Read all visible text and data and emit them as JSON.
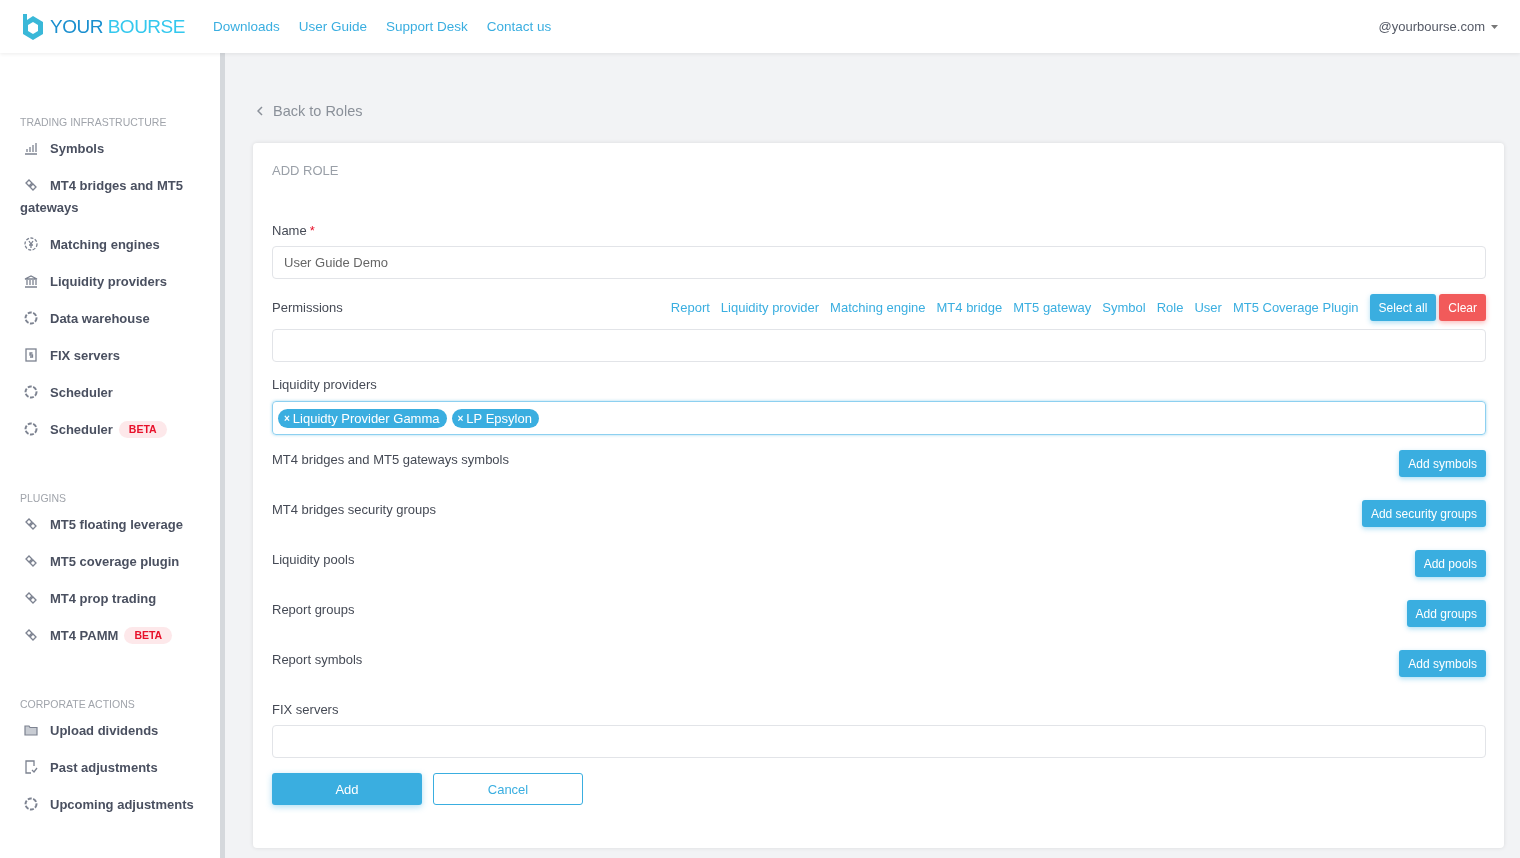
{
  "header": {
    "brand": {
      "first": "YOUR",
      "second": "BOURSE"
    },
    "nav": [
      "Downloads",
      "User Guide",
      "Support Desk",
      "Contact us"
    ],
    "account": "@yourbourse.com"
  },
  "sidebar": [
    {
      "title": "TRADING INFRASTRUCTURE",
      "items": [
        {
          "label": "Symbols",
          "kind": "chart"
        },
        {
          "label": "MT4 bridges and MT5 gateways",
          "kind": "link"
        },
        {
          "label": "Matching engines",
          "kind": "coin"
        },
        {
          "label": "Liquidity providers",
          "kind": "bank"
        },
        {
          "label": "Data warehouse",
          "kind": "ring"
        },
        {
          "label": "FIX servers",
          "kind": "doc"
        },
        {
          "label": "Scheduler",
          "kind": "ring"
        },
        {
          "label": "Scheduler",
          "kind": "ring",
          "badge": "BETA"
        }
      ]
    },
    {
      "title": "PLUGINS",
      "items": [
        {
          "label": "MT5 floating leverage",
          "kind": "link"
        },
        {
          "label": "MT5 coverage plugin",
          "kind": "link"
        },
        {
          "label": "MT4 prop trading",
          "kind": "link"
        },
        {
          "label": "MT4 PAMM",
          "kind": "link",
          "badge": "BETA"
        }
      ]
    },
    {
      "title": "CORPORATE ACTIONS",
      "items": [
        {
          "label": "Upload dividends",
          "kind": "folder"
        },
        {
          "label": "Past adjustments",
          "kind": "check"
        },
        {
          "label": "Upcoming adjustments",
          "kind": "ring"
        }
      ]
    }
  ],
  "back_link": "Back to Roles",
  "card_title": "ADD ROLE",
  "fields": [
    {
      "kind": "text",
      "label": "Name",
      "required_mark": "*",
      "value": "User Guide Demo"
    },
    {
      "kind": "permissions",
      "label": "Permissions",
      "links": [
        "Report",
        "Liquidity provider",
        "Matching engine",
        "MT4 bridge",
        "MT5 gateway",
        "Symbol",
        "Role",
        "User",
        "MT5 Coverage Plugin"
      ],
      "select_all": "Select all",
      "clear": "Clear"
    },
    {
      "kind": "tags",
      "label": "Liquidity providers",
      "tags": [
        {
          "remove": "×",
          "label": "Liquidty Provider Gamma"
        },
        {
          "remove": "×",
          "label": "LP Epsylon"
        }
      ]
    },
    {
      "kind": "action",
      "label": "MT4 bridges and MT5 gateways symbols",
      "button": "Add symbols"
    },
    {
      "kind": "action",
      "label": "MT4 bridges security groups",
      "button": "Add security groups"
    },
    {
      "kind": "action",
      "label": "Liquidity pools",
      "button": "Add pools"
    },
    {
      "kind": "action",
      "label": "Report groups",
      "button": "Add groups"
    },
    {
      "kind": "action",
      "label": "Report symbols",
      "button": "Add symbols"
    },
    {
      "kind": "text",
      "label": "FIX servers"
    }
  ],
  "buttons": {
    "submit": "Add",
    "cancel": "Cancel"
  }
}
